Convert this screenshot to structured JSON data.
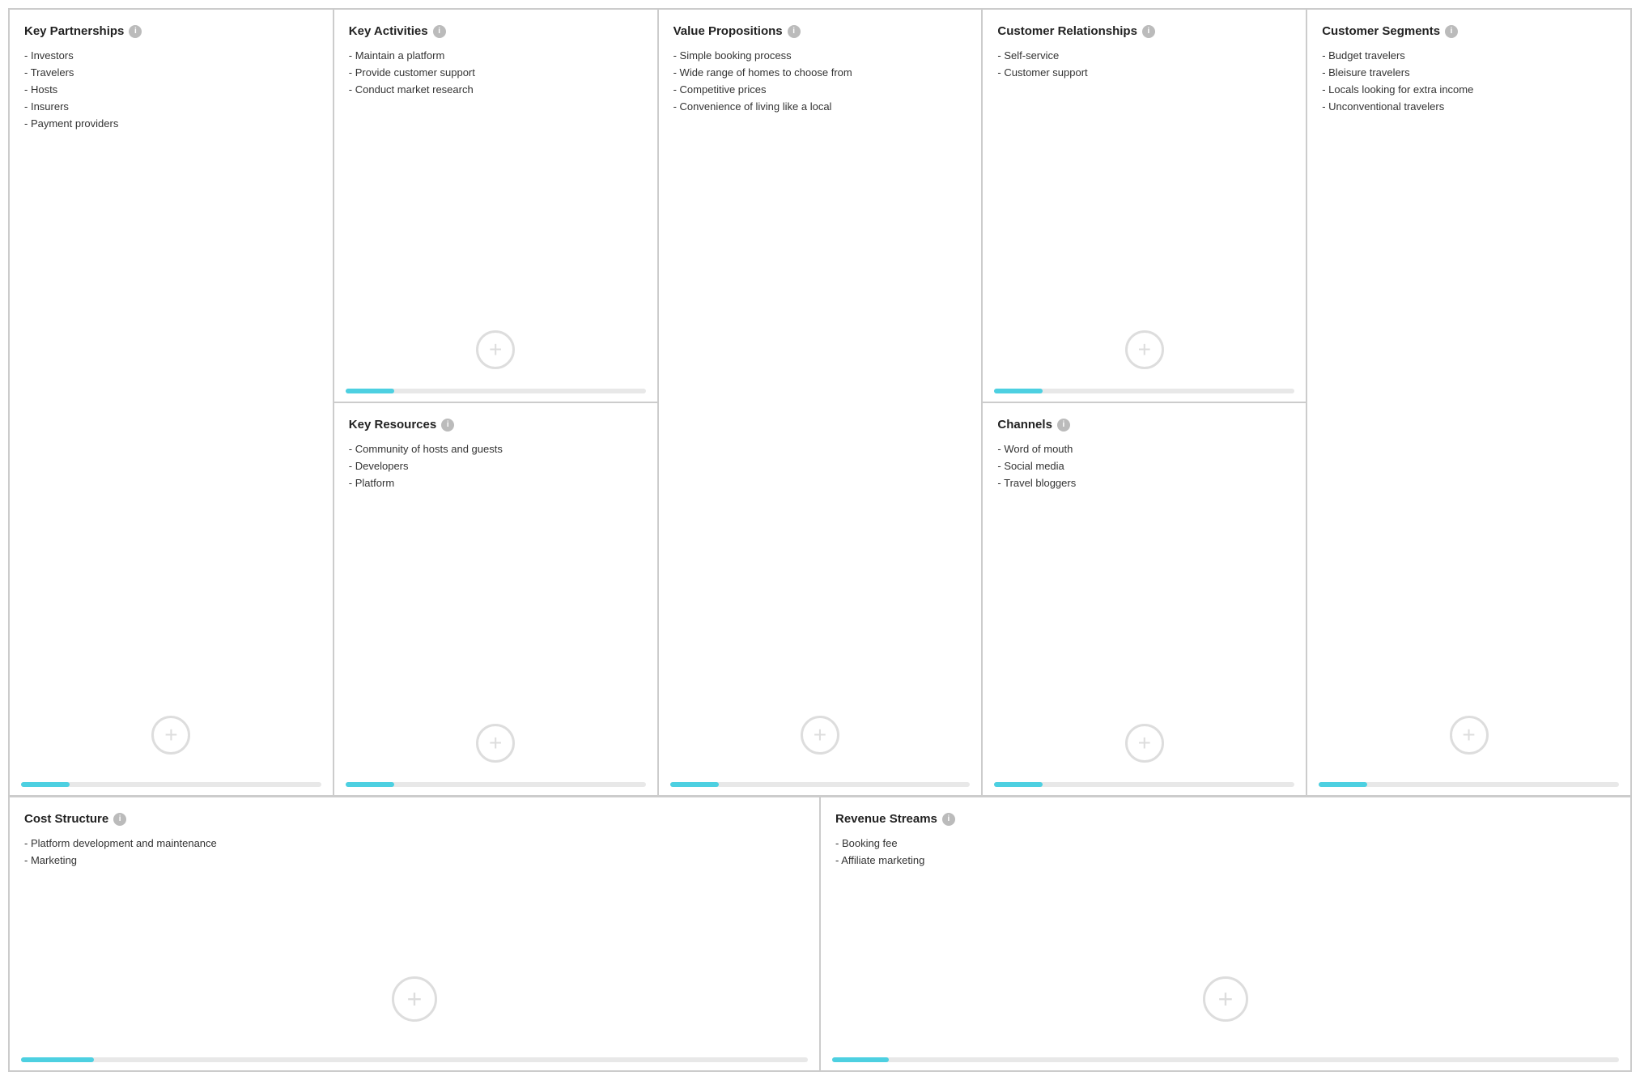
{
  "cells": {
    "key_partnerships": {
      "title": "Key Partnerships",
      "items": [
        "Investors",
        "Travelers",
        "Hosts",
        "Insurers",
        "Payment providers"
      ]
    },
    "key_activities": {
      "title": "Key Activities",
      "items": [
        "Maintain a platform",
        "Provide customer support",
        "Conduct market research"
      ]
    },
    "key_resources": {
      "title": "Key Resources",
      "items": [
        "Community of hosts and guests",
        "Developers",
        "Platform"
      ]
    },
    "value_propositions": {
      "title": "Value Propositions",
      "items": [
        "Simple booking process",
        "Wide range of homes to choose from",
        "Competitive prices",
        "Convenience of living like a local"
      ]
    },
    "customer_relationships": {
      "title": "Customer Relationships",
      "items": [
        "Self-service",
        "Customer support"
      ]
    },
    "channels": {
      "title": "Channels",
      "items": [
        "Word of mouth",
        "Social media",
        "Travel bloggers"
      ]
    },
    "customer_segments": {
      "title": "Customer Segments",
      "items": [
        "Budget travelers",
        "Bleisure travelers",
        "Locals looking for extra income",
        "Unconventional travelers"
      ]
    },
    "cost_structure": {
      "title": "Cost Structure",
      "items": [
        "Platform development and maintenance",
        "Marketing"
      ]
    },
    "revenue_streams": {
      "title": "Revenue Streams",
      "items": [
        "Booking fee",
        "Affiliate marketing"
      ]
    }
  },
  "icons": {
    "info": "i",
    "add": "+"
  }
}
